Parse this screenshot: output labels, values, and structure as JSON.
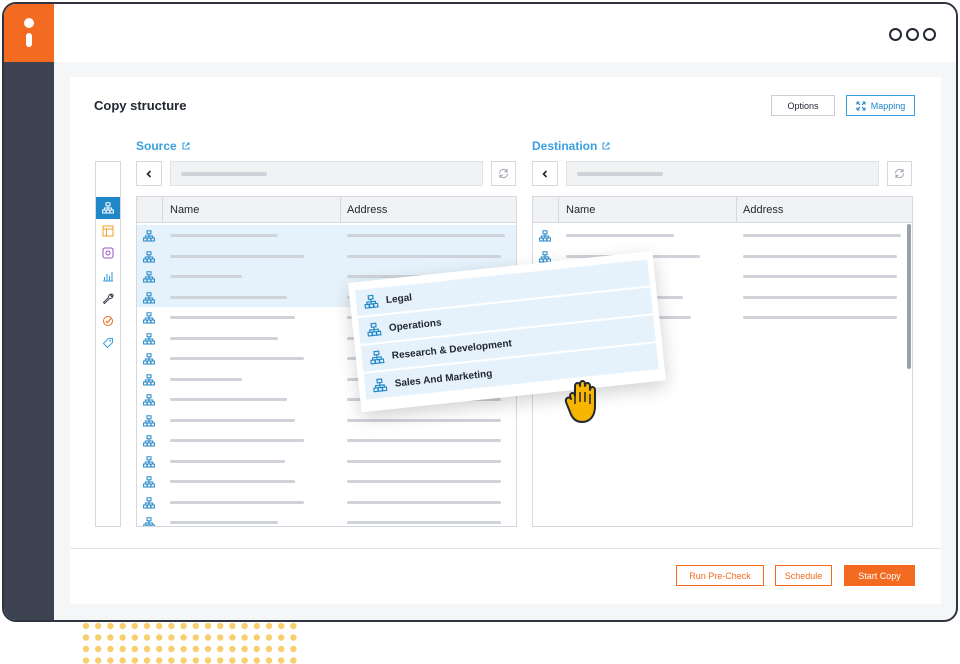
{
  "window": {
    "menu_icon": "three-dots-icon",
    "brand_icon": "info-icon"
  },
  "header": {
    "title": "Copy structure",
    "options_label": "Options",
    "mapping_label": "Mapping",
    "mapping_icon": "expand-arrows-icon"
  },
  "source": {
    "title": "Source",
    "columns": [
      "Name",
      "Address"
    ],
    "rows": 15,
    "selected_rows": 4
  },
  "destination": {
    "title": "Destination",
    "columns": [
      "Name",
      "Address"
    ],
    "rows": 5
  },
  "toolbar": {
    "items": [
      "hierarchy-icon",
      "table-icon",
      "app-icon",
      "chart-icon",
      "wrench-icon",
      "checkmark-icon",
      "tag-icon"
    ],
    "active_index": 0
  },
  "drag": {
    "items": [
      "Legal",
      "Operations",
      "Research & Development",
      "Sales And Marketing"
    ]
  },
  "footer": {
    "precheck_label": "Run Pre-Check",
    "schedule_label": "Schedule",
    "start_label": "Start Copy"
  },
  "colors": {
    "accent": "#f26b21",
    "link": "#3aa1e0",
    "selected": "#e6f2fb"
  }
}
